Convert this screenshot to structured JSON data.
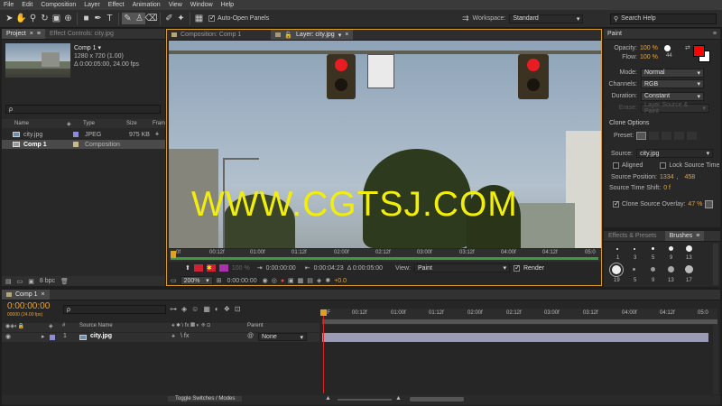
{
  "menu": [
    "File",
    "Edit",
    "Composition",
    "Layer",
    "Effect",
    "Animation",
    "View",
    "Window",
    "Help"
  ],
  "toolbar": {
    "auto_open_label": "Auto-Open Panels",
    "workspace_label": "Workspace:",
    "workspace_value": "Standard",
    "search_placeholder": "Search Help"
  },
  "project": {
    "tab_label": "Project",
    "effects_tab": "Effect Controls: city.jpg",
    "comp_name": "Comp 1 ▾",
    "comp_res": "1280 x 720 (1.00)",
    "comp_dur": "Δ 0:00:05:00, 24.00 fps",
    "search_placeholder": "ρ",
    "columns": [
      "Name",
      "Type",
      "Size",
      "Fram"
    ],
    "items": [
      {
        "name": "city.jpg",
        "type": "JPEG",
        "size": "975 KB",
        "color": "#8c8cd9"
      },
      {
        "name": "Comp 1",
        "type": "Composition",
        "size": "",
        "color": "#c9b987"
      }
    ],
    "bpc": "8 bpc"
  },
  "viewer": {
    "comp_tab": "Composition: Comp 1",
    "layer_tab": "Layer: city.jpg",
    "watermark": "WWW.CGTSJ.COM",
    "ruler_ticks": [
      "0f",
      "00:12f",
      "01:00f",
      "01:12f",
      "02:00f",
      "02:12f",
      "03:00f",
      "03:12f",
      "04:00f",
      "04:12f",
      "05:0"
    ],
    "tc_start": "0:00:00:00",
    "tc_end": "0:00:04:23",
    "tc_dur": "Δ 0:00:05:00",
    "view_label": "View:",
    "view_value": "Paint",
    "render_label": "Render",
    "zoom": "200%",
    "tc_bottom": "0:00:00:00",
    "exposure": "+0.0",
    "opacity_label": "100 %"
  },
  "paint": {
    "title": "Paint",
    "opacity_label": "Opacity:",
    "opacity_value": "100 %",
    "flow_label": "Flow:",
    "flow_value": "100 %",
    "brush_size": "44",
    "mode_label": "Mode:",
    "mode_value": "Normal",
    "channels_label": "Channels:",
    "channels_value": "RGB",
    "duration_label": "Duration:",
    "duration_value": "Constant",
    "erase_label": "Erase:",
    "erase_value": "Layer Source & Paint",
    "clone_title": "Clone Options",
    "preset_label": "Preset:",
    "source_label": "Source:",
    "source_value": "city.jpg",
    "aligned_label": "Aligned",
    "lock_label": "Lock Source Time",
    "source_pos_label": "Source Position:",
    "source_pos_x": "1334",
    "source_pos_y": "458",
    "shift_label": "Source Time Shift:",
    "shift_value": "0 f",
    "overlay_label": "Clone Source Overlay:",
    "overlay_value": "47 %",
    "fg_color": "#ff0000",
    "bg_color": "#ffffff"
  },
  "effects_tab": "Effects & Presets",
  "brushes_tab": "Brushes",
  "brushes": [
    "1",
    "3",
    "5",
    "9",
    "13",
    "19",
    "5",
    "9",
    "13",
    "17"
  ],
  "timeline": {
    "tab": "Comp 1",
    "timecode": "0:00:00:00",
    "fps": "00000 (24.00 fps)",
    "search_placeholder": "ρ",
    "col_num": "#",
    "col_source": "Source Name",
    "col_parent": "Parent",
    "layer_num": "1",
    "layer_name": "city.jpg",
    "parent_value": "None",
    "ticks": [
      "0F",
      "00:12f",
      "01:00f",
      "01:12f",
      "02:00f",
      "02:12f",
      "03:00f",
      "03:12f",
      "04:00f",
      "04:12f",
      "05:0"
    ],
    "toggle_label": "Toggle Switches / Modes"
  }
}
